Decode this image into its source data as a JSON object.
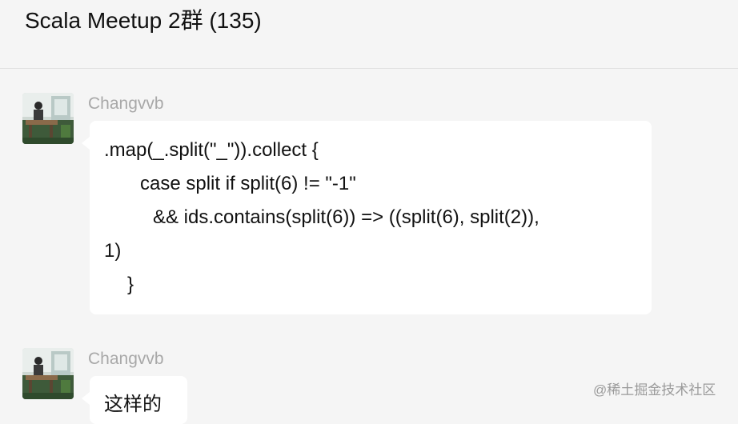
{
  "header": {
    "title": "Scala Meetup 2群 (135)"
  },
  "messages": [
    {
      "sender": "Changvvb",
      "lines": [
        ".map(_.split(\"_\")).collect {",
        "case split if split(6) != \"-1\"",
        "&& ids.contains(split(6)) => ((split(6), split(2)),",
        "1)",
        "}"
      ]
    },
    {
      "sender": "Changvvb",
      "text": "这样的"
    }
  ],
  "watermark": "@稀土掘金技术社区",
  "colors": {
    "background": "#f5f5f5",
    "bubble": "#ffffff",
    "sender": "#a8a8a8"
  },
  "icons": {
    "avatar": "user-photo-avatar"
  }
}
